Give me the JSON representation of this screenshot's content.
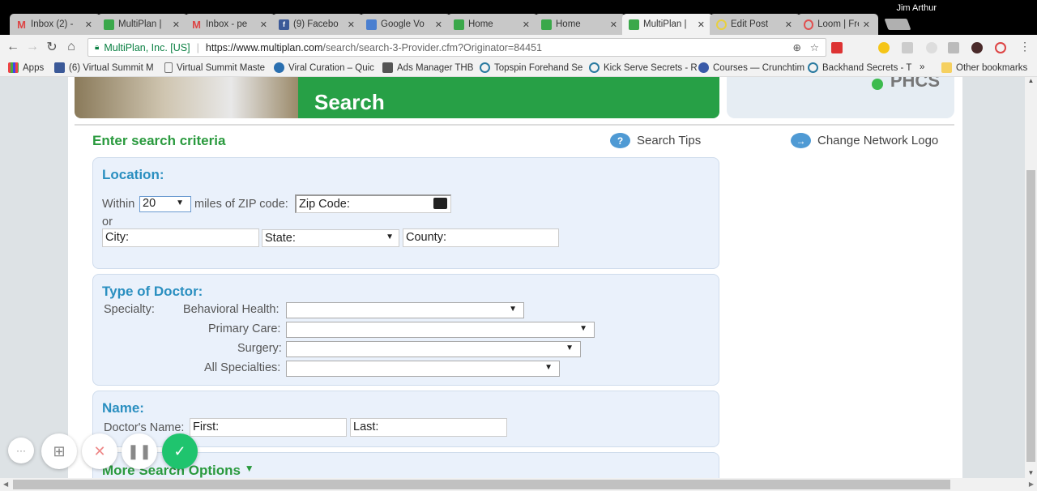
{
  "browser": {
    "user": "Jim Arthur",
    "tabs": [
      {
        "label": "Inbox (2) -",
        "icon": "gmail-icon",
        "active": false
      },
      {
        "label": "MultiPlan |",
        "icon": "multiplan-icon",
        "active": false
      },
      {
        "label": "Inbox - pe",
        "icon": "gmail-icon",
        "active": false
      },
      {
        "label": "(9) Facebo",
        "icon": "facebook-icon",
        "active": false
      },
      {
        "label": "Google Vo",
        "icon": "google-voice-icon",
        "active": false
      },
      {
        "label": "Home",
        "icon": "multiplan-icon",
        "active": false
      },
      {
        "label": "Home",
        "icon": "multiplan-icon",
        "active": false
      },
      {
        "label": "MultiPlan |",
        "icon": "multiplan-icon",
        "active": true
      },
      {
        "label": "Edit Post",
        "icon": "wordpress-icon",
        "active": false
      },
      {
        "label": "Loom | Fre",
        "icon": "loom-icon",
        "active": false
      }
    ],
    "address": {
      "site": "MultiPlan, Inc. [US]",
      "host": "https://www.multiplan.com",
      "path": "/search/search-3-Provider.cfm?Originator=84451"
    },
    "bookmarks": [
      "Apps",
      "(6) Virtual Summit M",
      "Virtual Summit Maste",
      "Viral Curation – Quic",
      "Ads Manager THB",
      "Topspin Forehand Se",
      "Kick Serve Secrets - R",
      "Courses — Crunchtim",
      "Backhand Secrets - T",
      "»",
      "Other bookmarks"
    ]
  },
  "page": {
    "banner_title": "Search",
    "logo_text": "PHCS",
    "criteria_heading": "Enter search criteria",
    "search_tips": "Search Tips",
    "change_logo": "Change Network Logo",
    "location": {
      "heading": "Location:",
      "within": "Within",
      "miles_value": "20",
      "miles_of": "miles of ZIP code:",
      "zip_placeholder": "Zip Code:",
      "or": "or",
      "city_placeholder": "City:",
      "state_placeholder": "State:",
      "county_placeholder": "County:"
    },
    "doctor": {
      "heading": "Type of Doctor:",
      "specialty": "Specialty:",
      "behavioral": "Behavioral Health:",
      "primary": "Primary Care:",
      "surgery": "Surgery:",
      "all": "All Specialties:"
    },
    "name": {
      "heading": "Name:",
      "label": "Doctor's Name:",
      "first_placeholder": "First:",
      "last_placeholder": "Last:"
    },
    "more_options": "More Search Options"
  },
  "colors": {
    "green": "#27a046",
    "blue_heading": "#2a8fc0"
  }
}
